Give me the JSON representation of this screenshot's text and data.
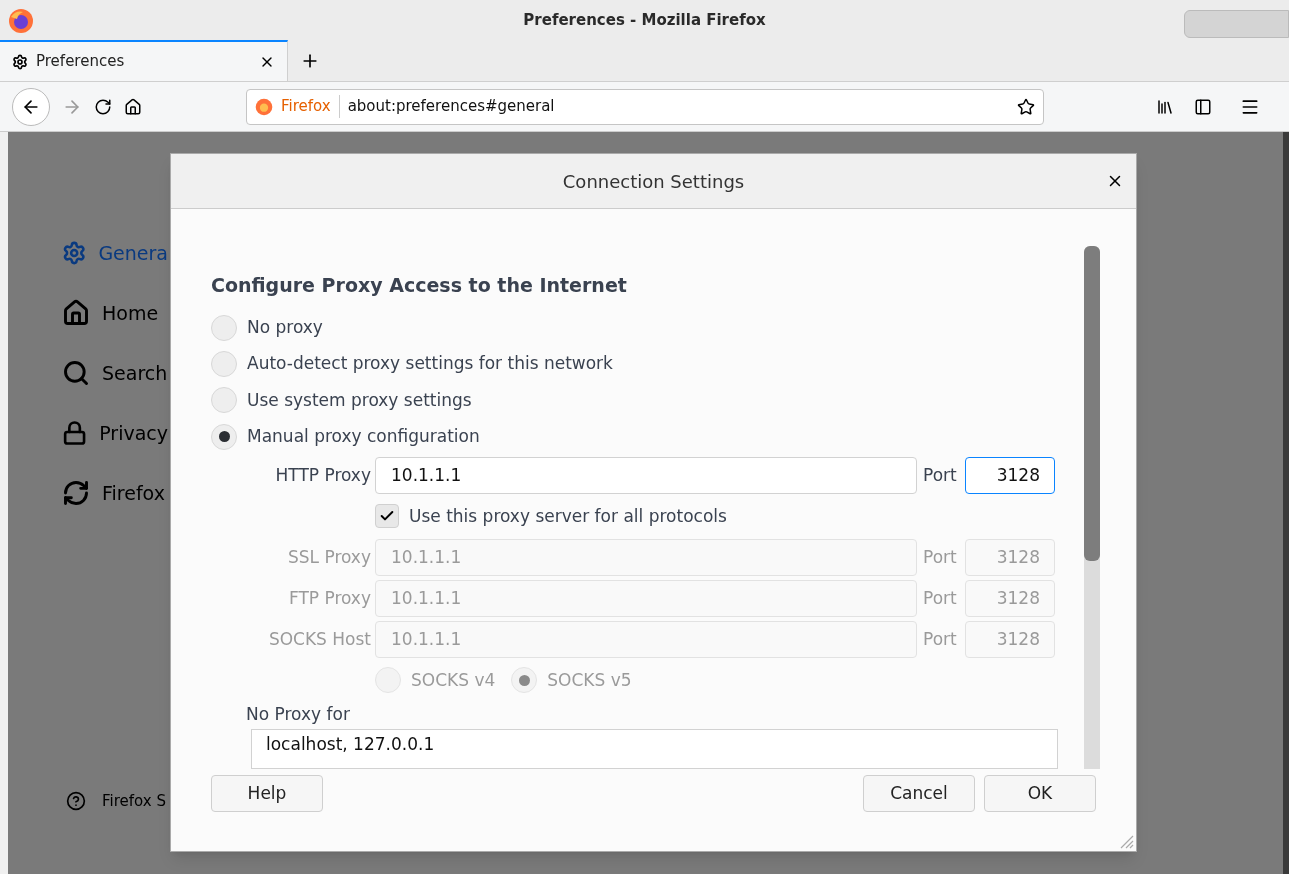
{
  "window": {
    "title": "Preferences - Mozilla Firefox"
  },
  "tabs": [
    {
      "label": "Preferences",
      "selected": true
    }
  ],
  "toolbar": {
    "identity": "Firefox",
    "url": "about:preferences#general"
  },
  "sidebar": {
    "items": [
      {
        "label": "Genera",
        "selected": true
      },
      {
        "label": "Home",
        "selected": false
      },
      {
        "label": "Search",
        "selected": false
      },
      {
        "label": "Privacy",
        "selected": false
      },
      {
        "label": "Firefox",
        "selected": false
      }
    ],
    "footer": "Firefox S"
  },
  "dialog": {
    "title": "Connection Settings",
    "heading": "Configure Proxy Access to the Internet",
    "modes": [
      {
        "label": "No proxy",
        "selected": false
      },
      {
        "label": "Auto-detect proxy settings for this network",
        "selected": false
      },
      {
        "label": "Use system proxy settings",
        "selected": false
      },
      {
        "label": "Manual proxy configuration",
        "selected": true
      }
    ],
    "proxies": [
      {
        "label": "HTTP Proxy",
        "value": "10.1.1.1",
        "port_label": "Port",
        "port": "3128",
        "disabled": false,
        "focused": true
      },
      {
        "kind": "checkbox"
      },
      {
        "label": "SSL Proxy",
        "value": "10.1.1.1",
        "port_label": "Port",
        "port": "3128",
        "disabled": true,
        "focused": false
      },
      {
        "label": "FTP Proxy",
        "value": "10.1.1.1",
        "port_label": "Port",
        "port": "3128",
        "disabled": true,
        "focused": false
      },
      {
        "label": "SOCKS Host",
        "value": "10.1.1.1",
        "port_label": "Port",
        "port": "3128",
        "disabled": true,
        "focused": false
      }
    ],
    "share_all": {
      "label": "Use this proxy server for all protocols",
      "checked": true
    },
    "socks_versions": [
      {
        "label": "SOCKS v4",
        "selected": false
      },
      {
        "label": "SOCKS v5",
        "selected": true
      }
    ],
    "no_proxy_label": "No Proxy for",
    "no_proxy_value": "localhost, 127.0.0.1",
    "buttons": [
      {
        "label": "Help"
      },
      {
        "label": "Cancel"
      },
      {
        "label": "OK"
      }
    ]
  }
}
